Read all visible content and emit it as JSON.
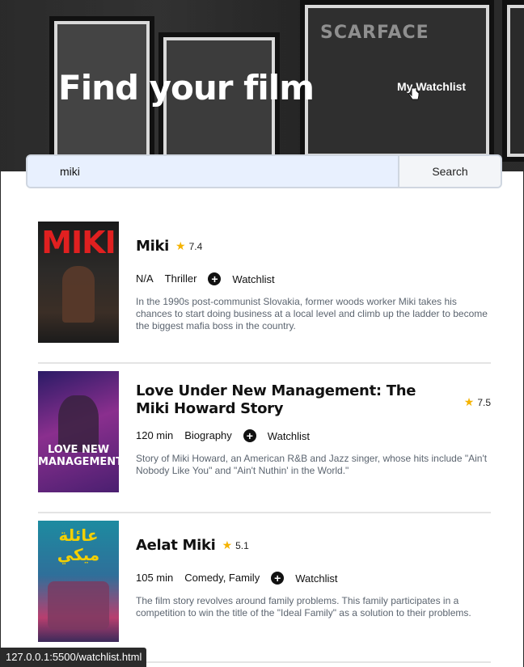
{
  "hero": {
    "title": "Find your film",
    "watchlist_link": "My Watchlist",
    "poster_wall_text": "SCARFACE"
  },
  "search": {
    "value": "miki",
    "button_label": "Search"
  },
  "films": [
    {
      "title": "Miki",
      "rating": "7.4",
      "runtime": "N/A",
      "genre": "Thriller",
      "watchlist_label": "Watchlist",
      "description": "In the 1990s post-communist Slovakia, former woods worker Miki takes his chances to start doing business at a local level and climb up the ladder to become the biggest mafia boss in the country.",
      "poster_text": "MIKI"
    },
    {
      "title": "Love Under New Management: The Miki Howard Story",
      "rating": "7.5",
      "runtime": "120 min",
      "genre": "Biography",
      "watchlist_label": "Watchlist",
      "description": "Story of Miki Howard, an American R&B and Jazz singer, whose hits include \"Ain't Nobody Like You\" and \"Ain't Nuthin' in the World.\"",
      "poster_text": "LOVE NEW MANAGEMENT"
    },
    {
      "title": "Aelat Miki",
      "rating": "5.1",
      "runtime": "105 min",
      "genre": "Comedy, Family",
      "watchlist_label": "Watchlist",
      "description": "The film story revolves around family problems. This family participates in a competition to win the title of the \"Ideal Family\" as a solution to their problems.",
      "poster_text": "عائلة ميكي"
    }
  ],
  "statusbar": {
    "url": "127.0.0.1:5500/watchlist.html"
  },
  "colors": {
    "star": "#f5b301",
    "description_text": "#5c6570",
    "search_bg": "#e8f0fe"
  },
  "icons": [
    "star-icon",
    "plus-circle-icon",
    "hand-cursor-icon"
  ]
}
